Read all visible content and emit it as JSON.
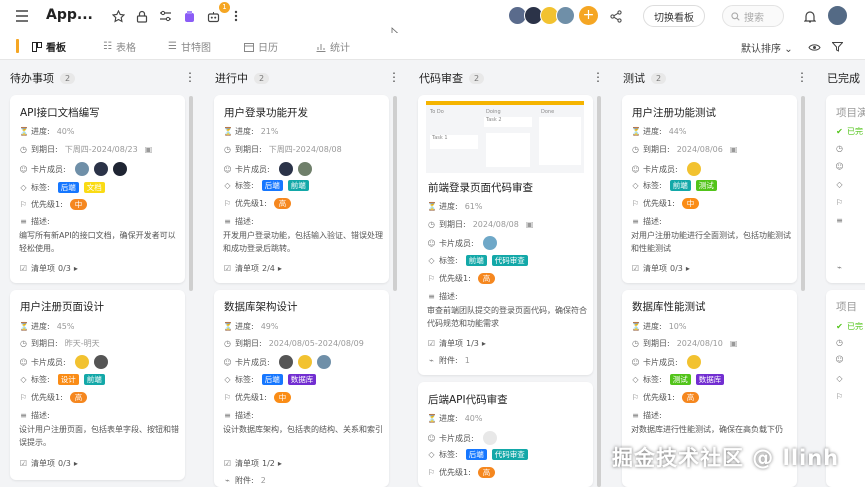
{
  "header": {
    "app_title": "App...",
    "notification_count": "1",
    "switch_board_label": "切换看板",
    "search_placeholder": "搜索"
  },
  "views": {
    "tabs": [
      {
        "label": "看板",
        "icon": "board-icon",
        "active": true
      },
      {
        "label": "表格",
        "icon": "table-icon",
        "active": false
      },
      {
        "label": "甘特图",
        "icon": "gantt-icon",
        "active": false
      },
      {
        "label": "日历",
        "icon": "calendar-icon",
        "active": false
      },
      {
        "label": "统计",
        "icon": "chart-icon",
        "active": false
      }
    ],
    "sort_label": "默认排序"
  },
  "labels": {
    "progress": "进度:",
    "due": "到期日:",
    "members": "卡片成员:",
    "tags": "标签:",
    "priority": "优先级1:",
    "desc": "描述:",
    "checklist": "清单项",
    "attachments": "附件:"
  },
  "columns": [
    {
      "name": "待办事项",
      "count": "2"
    },
    {
      "name": "进行中",
      "count": "2"
    },
    {
      "name": "代码审查",
      "count": "2"
    },
    {
      "name": "测试",
      "count": "2"
    },
    {
      "name": "已完成"
    }
  ],
  "cards": {
    "c1": {
      "title": "API接口文档编写",
      "progress": "40%",
      "due": "下周四-2024/08/23",
      "tags": [
        "后端",
        "文档"
      ],
      "priority": "中",
      "desc": "编写所有新API的接口文档，确保开发者可以轻松使用。",
      "checklist": "0/3"
    },
    "c2": {
      "title": "用户注册页面设计",
      "progress": "45%",
      "due": "昨天-明天",
      "tags": [
        "设计",
        "前端"
      ],
      "priority": "高",
      "desc": "设计用户注册页面，包括表单字段、按钮和错误提示。",
      "checklist": "0/3"
    },
    "c3": {
      "title": "用户登录功能开发",
      "progress": "21%",
      "due": "下周四-2024/08/08",
      "tags": [
        "后端",
        "前端"
      ],
      "priority": "高",
      "desc": "开发用户登录功能，包括输入验证、错误处理和成功登录后跳转。",
      "checklist": "2/4"
    },
    "c4": {
      "title": "数据库架构设计",
      "progress": "49%",
      "due": "2024/08/05-2024/08/09",
      "tags": [
        "后端",
        "数据库"
      ],
      "priority": "中",
      "desc": "设计数据库架构，包括表的结构、关系和索引",
      "checklist": "1/2",
      "attachments": "2"
    },
    "c5": {
      "title": "前端登录页面代码审查",
      "progress": "61%",
      "due": "2024/08/08",
      "tags": [
        "前端",
        "代码审查"
      ],
      "priority": "高",
      "desc": "审查前端团队提交的登录页面代码，确保符合代码规范和功能需求",
      "checklist": "1/3",
      "attachments": "1"
    },
    "c6": {
      "title": "后端API代码审查",
      "progress": "40%",
      "tags": [
        "后端",
        "代码审查"
      ],
      "priority": "高"
    },
    "c7": {
      "title": "用户注册功能测试",
      "progress": "44%",
      "due": "2024/08/06",
      "tags": [
        "前端",
        "测试"
      ],
      "priority": "中",
      "desc": "对用户注册功能进行全面测试，包括功能测试和性能测试",
      "checklist": "0/3"
    },
    "c8": {
      "title": "数据库性能测试",
      "progress": "10%",
      "due": "2024/08/10",
      "tags": [
        "测试",
        "数据库"
      ],
      "priority": "高",
      "desc": "对数据库进行性能测试，确保在高负载下仍"
    },
    "c9": {
      "title": "项目演",
      "status": "已完"
    },
    "c10": {
      "title": "项目",
      "status": "已完"
    }
  },
  "thumbnail": {
    "col1": "To Do",
    "col2": "Doing",
    "col3": "Done",
    "card1": "Task 2",
    "card2": "Task 1"
  },
  "watermark": "掘金技术社区 @ llinh",
  "colors": {
    "accent": "#f5a623",
    "tag_blue": "#1677ff",
    "tag_teal": "#13a8a8",
    "tag_yellow": "#fadb14",
    "tag_orange": "#fa8c16",
    "tag_green": "#52c41a",
    "tag_purple": "#722ed1",
    "priority": "#f5871f"
  }
}
